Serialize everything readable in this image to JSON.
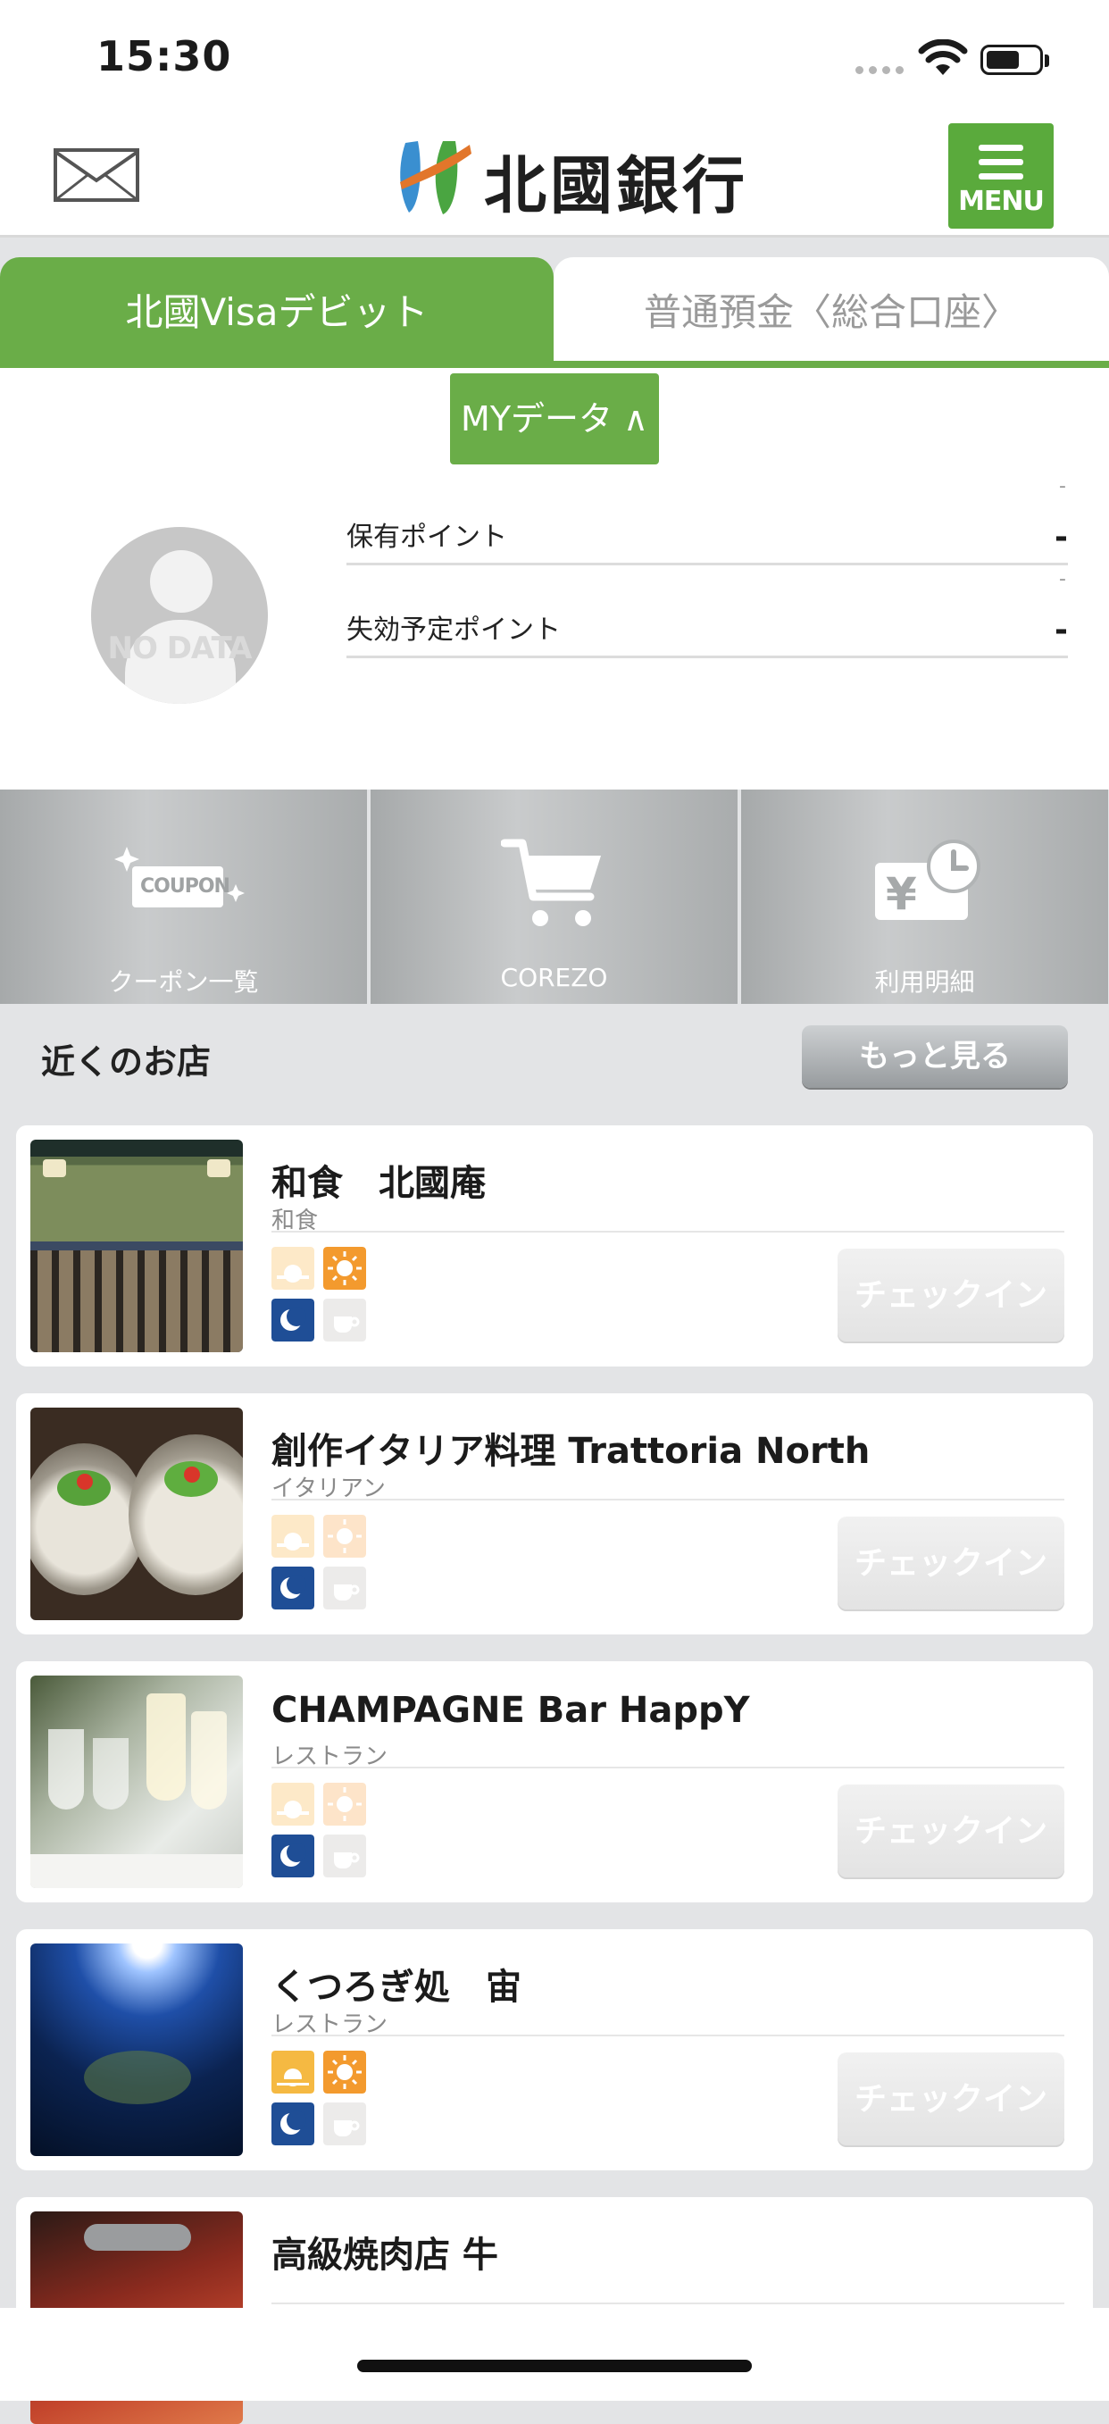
{
  "status_bar": {
    "time": "15:30"
  },
  "header": {
    "logo_text": "北國銀行",
    "menu_label": "MENU",
    "icons": {
      "mail": "mail-icon",
      "menu": "hamburger-menu-icon"
    },
    "brand_color": "#5aaa3c"
  },
  "tabs": [
    {
      "label": "北國Visaデビット",
      "active": true
    },
    {
      "label": "普通預金〈総合口座〉",
      "active": false
    }
  ],
  "mydata": {
    "button_label": "MYデータ ∧",
    "avatar_text": "NO DATA",
    "rows": [
      {
        "label": "保有ポイント",
        "value": "-",
        "sub": "-"
      },
      {
        "label": "失効予定ポイント",
        "value": "-",
        "sub": "-"
      }
    ]
  },
  "tiles": [
    {
      "label": "クーポン一覧",
      "icon": "coupon-icon",
      "badge": "COUPON"
    },
    {
      "label": "COREZO",
      "icon": "cart-icon"
    },
    {
      "label": "利用明細",
      "icon": "yen-clock-icon",
      "currency": "¥"
    }
  ],
  "nearby": {
    "title": "近くのお店",
    "more_label": "もっと見る",
    "checkin_label": "チェックイン",
    "shops": [
      {
        "name": "和食　北國庵",
        "genre": "和食",
        "photo": "restaurant-entrance-photo",
        "icons": {
          "morning": "dim",
          "lunch": "on",
          "dinner": "on",
          "cafe": "dim"
        }
      },
      {
        "name": "創作イタリア料理 Trattoria North",
        "genre": "イタリアン",
        "photo": "oyster-dish-photo",
        "icons": {
          "morning": "dim",
          "lunch": "dim",
          "dinner": "on",
          "cafe": "dim"
        }
      },
      {
        "name": "CHAMPAGNE Bar HappY",
        "genre": "レストラン",
        "photo": "champagne-glasses-photo",
        "icons": {
          "morning": "dim",
          "lunch": "dim",
          "dinner": "on",
          "cafe": "dim"
        }
      },
      {
        "name": "くつろぎ処　宙",
        "genre": "レストラン",
        "photo": "earth-from-space-photo",
        "icons": {
          "morning": "on",
          "lunch": "on",
          "dinner": "on",
          "cafe": "dim"
        }
      },
      {
        "name": "高級焼肉店 牛",
        "genre": "",
        "photo": "grilled-meat-photo"
      }
    ]
  },
  "colors": {
    "green": "#6aad48",
    "morning": "#f5b942",
    "lunch": "#f39a2e",
    "dinner": "#1f4e96",
    "cafe_dim": "#ecebea"
  }
}
